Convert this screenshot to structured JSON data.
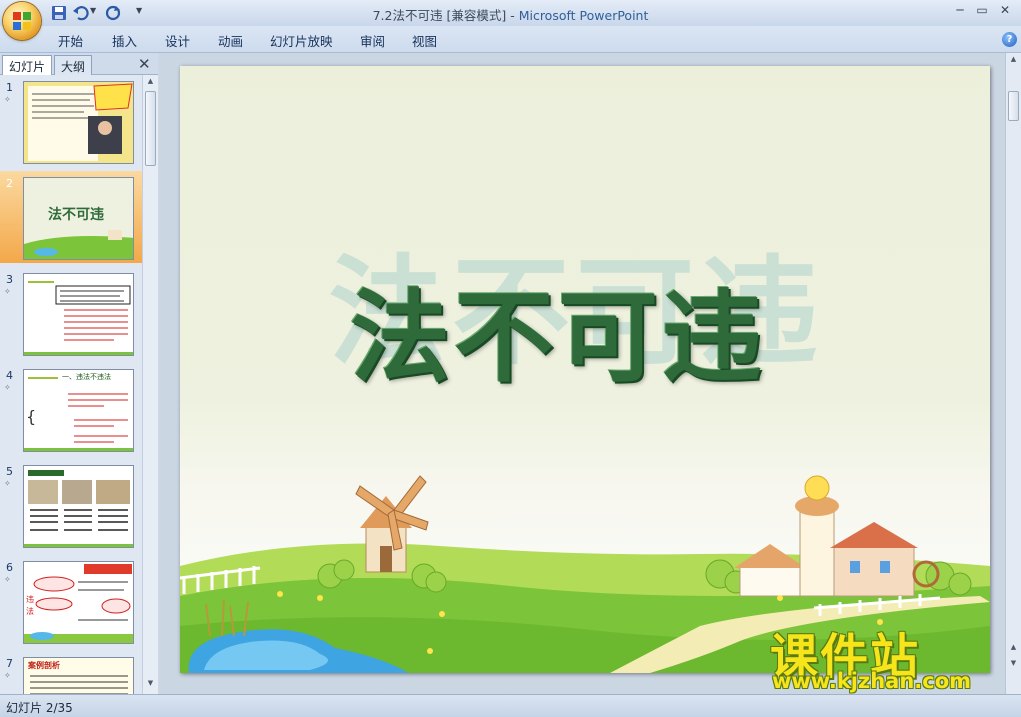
{
  "window": {
    "title_doc": "7.2法不可违 [兼容模式]",
    "title_sep": " - ",
    "title_app": "Microsoft PowerPoint"
  },
  "ribbon": {
    "tabs": [
      "开始",
      "插入",
      "设计",
      "动画",
      "幻灯片放映",
      "审阅",
      "视图"
    ]
  },
  "left_pane": {
    "tab_slides": "幻灯片",
    "tab_outline": "大纲",
    "selected_slide": 2,
    "thumbnails": [
      {
        "num": "1",
        "title": ""
      },
      {
        "num": "2",
        "title": "法不可违"
      },
      {
        "num": "3",
        "title": ""
      },
      {
        "num": "4",
        "title": "一、违法不违法"
      },
      {
        "num": "5",
        "title": ""
      },
      {
        "num": "6",
        "title": ""
      },
      {
        "num": "7",
        "title": "案例剖析"
      }
    ]
  },
  "slide": {
    "title": "法不可违",
    "ghost_title": "法不可违"
  },
  "watermark": {
    "brand": "课件站",
    "url": "www.kjzhan.com"
  },
  "status": {
    "slide_info": "幻灯片 2/35"
  },
  "colors": {
    "title_green": "#2f6a3a",
    "selection_orange": "#f3a84a",
    "watermark_yellow": "#f6e51a"
  }
}
